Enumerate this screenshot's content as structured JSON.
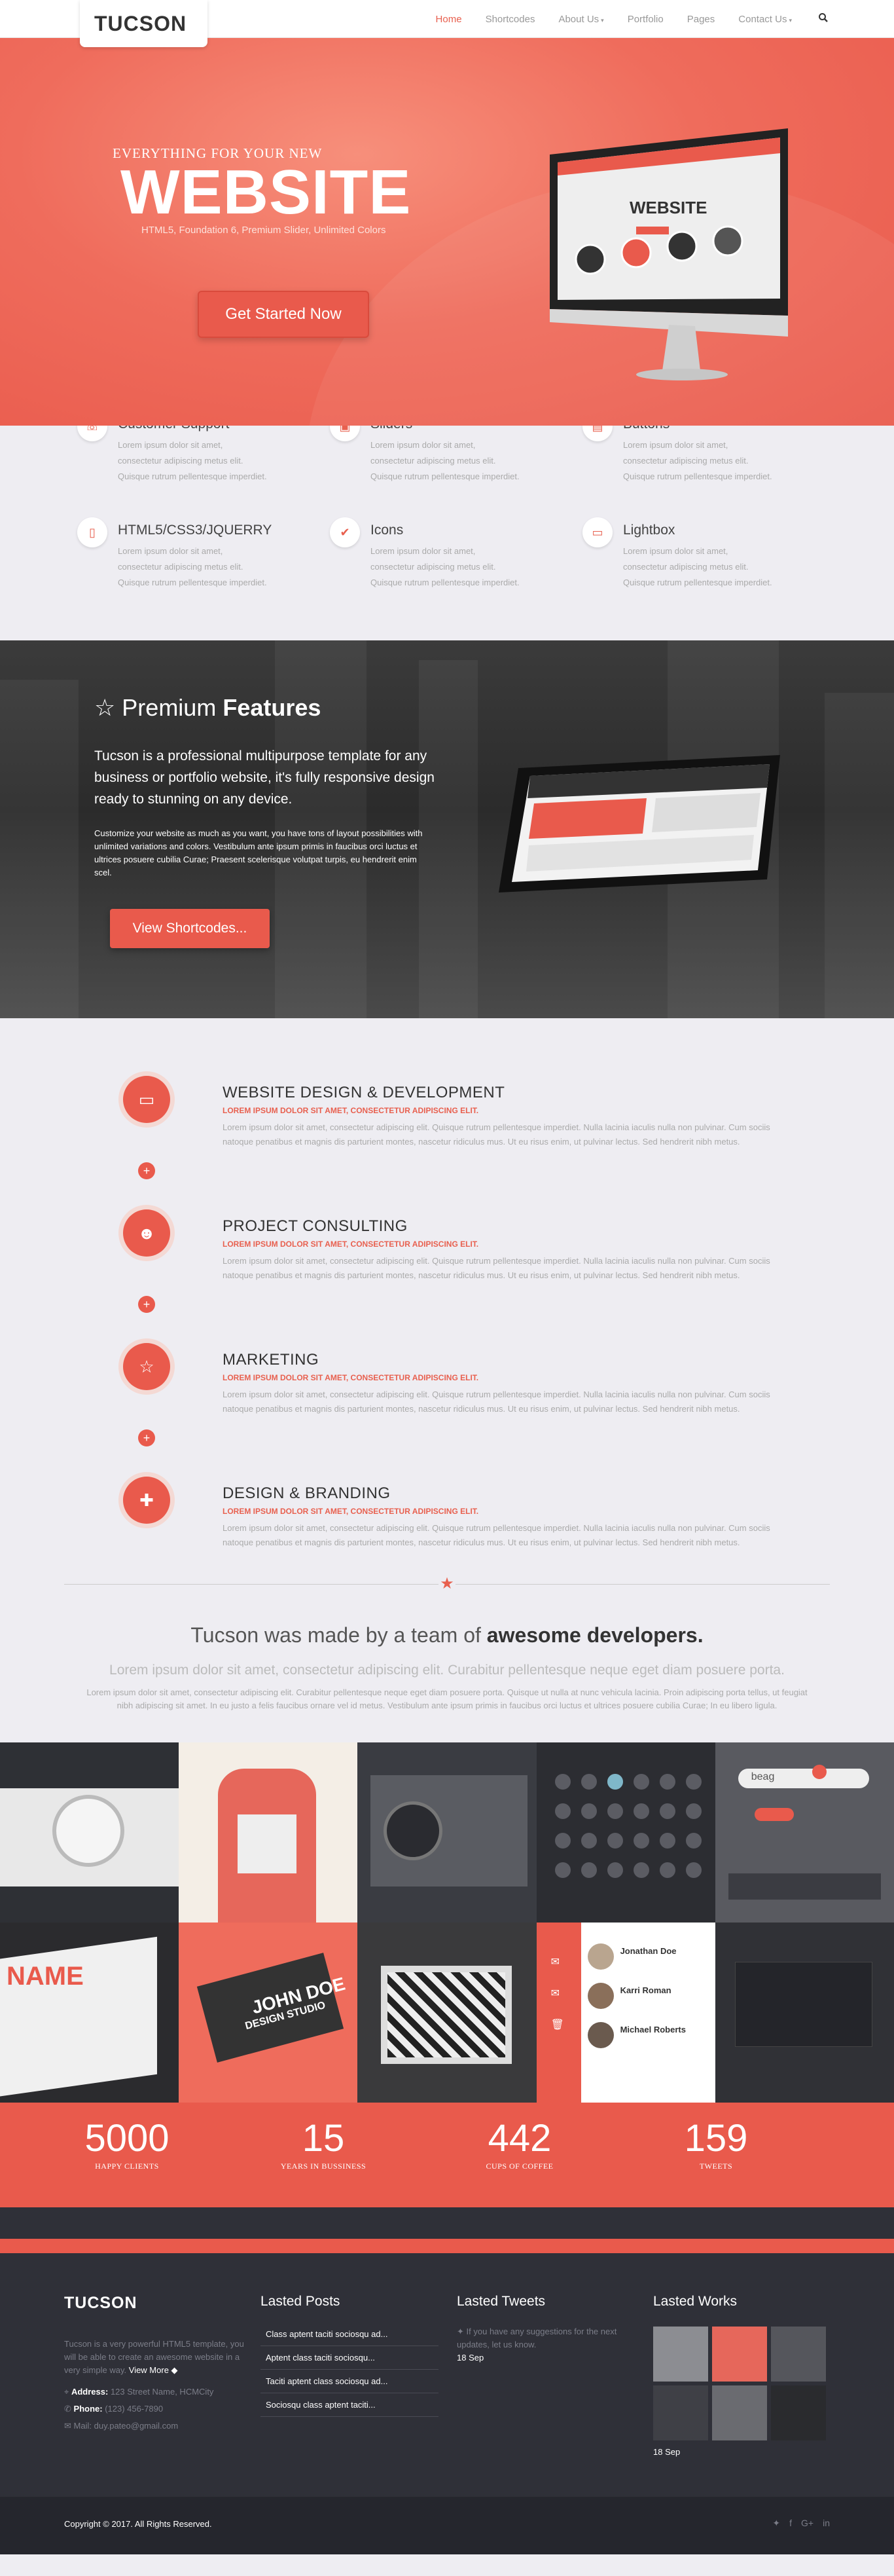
{
  "nav": {
    "logo": "TUCSON",
    "items": [
      {
        "label": "Home",
        "caret": ""
      },
      {
        "label": "Shortcodes",
        "caret": ""
      },
      {
        "label": "About Us",
        "caret": "▾"
      },
      {
        "label": "Portfolio",
        "caret": ""
      },
      {
        "label": "Pages",
        "caret": ""
      },
      {
        "label": "Contact Us",
        "caret": "▾"
      }
    ],
    "search_icon": "search-icon"
  },
  "hero": {
    "pre": "EVERYTHING FOR YOUR NEW",
    "title": "WEBSITE",
    "subtitle": "HTML5, Foundation 6, Premium Slider, Unlimited Colors",
    "button": "Get Started Now",
    "screen_title": "WEBSITE"
  },
  "services": [
    {
      "title": "Customer Support",
      "text": "Lorem ipsum dolor sit amet, consectetur adipiscing metus elit. Quisque rutrum pellentesque imperdiet.",
      "icon": "support-icon"
    },
    {
      "title": "Sliders",
      "text": "Lorem ipsum dolor sit amet, consectetur adipiscing metus elit. Quisque rutrum pellentesque imperdiet.",
      "icon": "sliders-icon"
    },
    {
      "title": "Buttons",
      "text": "Lorem ipsum dolor sit amet, consectetur adipiscing metus elit. Quisque rutrum pellentesque imperdiet.",
      "icon": "buttons-icon"
    },
    {
      "title": "HTML5/CSS3/JQUERRY",
      "text": "Lorem ipsum dolor sit amet, consectetur adipiscing metus elit. Quisque rutrum pellentesque imperdiet.",
      "icon": "file-icon"
    },
    {
      "title": "Icons",
      "text": "Lorem ipsum dolor sit amet, consectetur adipiscing metus elit. Quisque rutrum pellentesque imperdiet.",
      "icon": "check-icon"
    },
    {
      "title": "Lightbox",
      "text": "Lorem ipsum dolor sit amet, consectetur adipiscing metus elit. Quisque rutrum pellentesque imperdiet.",
      "icon": "monitor-icon"
    }
  ],
  "premium": {
    "heading_light": "Premium",
    "heading_bold": "Features",
    "lead": "Tucson is a professional multipurpose template for any business or portfolio website, it's fully responsive design ready to stunning on any device.",
    "body": "Customize your website as much as you want, you have tons of layout possibilities with unlimited variations and colors. Vestibulum ante ipsum primis in faucibus orci luctus et ultrices posuere cubilia Curae; Praesent scelerisque volutpat turpis, eu hendrerit enim scel.",
    "button": "View Shortcodes..."
  },
  "process": [
    {
      "title": "WEBSITE DESIGN & DEVELOPMENT",
      "sub": "LOREM IPSUM DOLOR SIT AMET, CONSECTETUR ADIPISCING ELIT.",
      "text": "Lorem ipsum dolor sit amet, consectetur adipiscing elit. Quisque rutrum pellentesque imperdiet. Nulla lacinia iaculis nulla non pulvinar. Cum sociis natoque penatibus et magnis dis parturient montes, nascetur ridiculus mus. Ut eu risus enim, ut pulvinar lectus. Sed hendrerit nibh metus.",
      "icon": "laptop-icon"
    },
    {
      "title": "PROJECT CONSULTING",
      "sub": "LOREM IPSUM DOLOR SIT AMET, CONSECTETUR ADIPISCING ELIT.",
      "text": "Lorem ipsum dolor sit amet, consectetur adipiscing elit. Quisque rutrum pellentesque imperdiet. Nulla lacinia iaculis nulla non pulvinar. Cum sociis natoque penatibus et magnis dis parturient montes, nascetur ridiculus mus. Ut eu risus enim, ut pulvinar lectus. Sed hendrerit nibh metus.",
      "icon": "users-icon"
    },
    {
      "title": "MARKETING",
      "sub": "LOREM IPSUM DOLOR SIT AMET, CONSECTETUR ADIPISCING ELIT.",
      "text": "Lorem ipsum dolor sit amet, consectetur adipiscing elit. Quisque rutrum pellentesque imperdiet. Nulla lacinia iaculis nulla non pulvinar. Cum sociis natoque penatibus et magnis dis parturient montes, nascetur ridiculus mus. Ut eu risus enim, ut pulvinar lectus. Sed hendrerit nibh metus.",
      "icon": "star-icon"
    },
    {
      "title": "DESIGN & BRANDING",
      "sub": "LOREM IPSUM DOLOR SIT AMET, CONSECTETUR ADIPISCING ELIT.",
      "text": "Lorem ipsum dolor sit amet, consectetur adipiscing elit. Quisque rutrum pellentesque imperdiet. Nulla lacinia iaculis nulla non pulvinar. Cum sociis natoque penatibus et magnis dis parturient montes, nascetur ridiculus mus. Ut eu risus enim, ut pulvinar lectus. Sed hendrerit nibh metus.",
      "icon": "puzzle-icon"
    }
  ],
  "team": {
    "heading_light": "Tucson was made by a team of",
    "heading_bold": "awesome developers.",
    "lead": "Lorem ipsum dolor sit amet, consectetur adipiscing elit. Curabitur pellentesque neque eget diam posuere porta.",
    "body": "Lorem ipsum dolor sit amet, consectetur adipiscing elit. Curabitur pellentesque neque eget diam posuere porta. Quisque ut nulla at nunc vehicula lacinia. Proin adipiscing porta tellus, ut feugiat nibh adipiscing sit amet. In eu justo a felis faucibus ornare vel id metus. Vestibulum ante ipsum primis in faucibus orci luctus et ultrices posuere cubilia Curae; In eu libero ligula."
  },
  "portfolio": {
    "search_text": "beag",
    "people": [
      "Jonathan Doe",
      "Karri Roman",
      "Michael Roberts"
    ],
    "card_text": "JOHN DOE",
    "card_sub": "DESIGN STUDIO",
    "book_text": "NAME"
  },
  "stats": [
    {
      "num": "5000",
      "label": "HAPPY CLIENTS"
    },
    {
      "num": "15",
      "label": "YEARS IN BUSSINESS"
    },
    {
      "num": "442",
      "label": "CUPS OF COFFEE"
    },
    {
      "num": "159",
      "label": "TWEETS"
    }
  ],
  "footer": {
    "logo": "TUCSON",
    "desc": "Tucson is a very powerful HTML5 template, you will be able to create an awesome website in a very simple way.",
    "view_more": "View More",
    "address_label": "Address:",
    "address": "123 Street Name, HCMCity",
    "phone_label": "Phone:",
    "phone": "(123) 456-7890",
    "mail_label": "Mail:",
    "mail": "duy.pateo@gmail.com",
    "posts_heading": "Lasted Posts",
    "posts": [
      "Class aptent taciti sociosqu ad...",
      "Aptent class taciti sociosqu...",
      "Taciti aptent class sociosqu ad...",
      "Sociosqu class aptent taciti..."
    ],
    "tweets_heading": "Lasted Tweets",
    "tweet": "If you have any suggestions for the next updates, let us know.",
    "tweet_date": "18 Sep",
    "works_heading": "Lasted Works",
    "works_date": "18 Sep",
    "copyright": "Copyright © 2017. All Rights Reserved."
  }
}
